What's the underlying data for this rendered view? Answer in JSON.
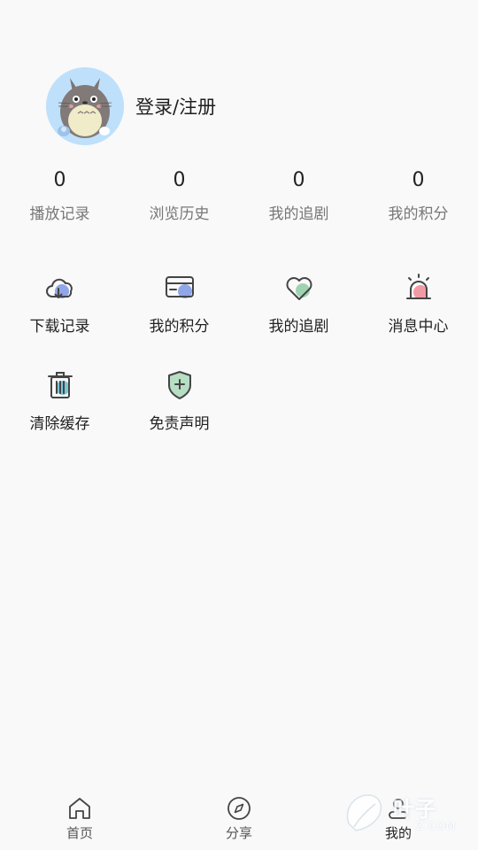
{
  "profile": {
    "login_label": "登录/注册"
  },
  "stats": [
    {
      "value": "0",
      "label": "播放记录"
    },
    {
      "value": "0",
      "label": "浏览历史"
    },
    {
      "value": "0",
      "label": "我的追剧"
    },
    {
      "value": "0",
      "label": "我的积分"
    }
  ],
  "menu": [
    {
      "label": "下载记录",
      "icon": "cloud-download-icon"
    },
    {
      "label": "我的积分",
      "icon": "card-icon"
    },
    {
      "label": "我的追剧",
      "icon": "heart-icon"
    },
    {
      "label": "消息中心",
      "icon": "alarm-icon"
    },
    {
      "label": "清除缓存",
      "icon": "trash-icon"
    },
    {
      "label": "免责声明",
      "icon": "shield-plus-icon"
    }
  ],
  "tabbar": [
    {
      "label": "首页",
      "icon": "home-icon"
    },
    {
      "label": "分享",
      "icon": "compass-icon"
    },
    {
      "label": "我的",
      "icon": "user-icon",
      "active": true
    }
  ],
  "watermark": {
    "text": "叶子",
    "sub": "Z.COM"
  },
  "colors": {
    "accent_blue": "#8fa6e8",
    "accent_green": "#9fd3b0",
    "accent_red": "#f19aa6",
    "accent_teal": "#7cc6d8",
    "avatar_bg": "#bfe0fb"
  }
}
